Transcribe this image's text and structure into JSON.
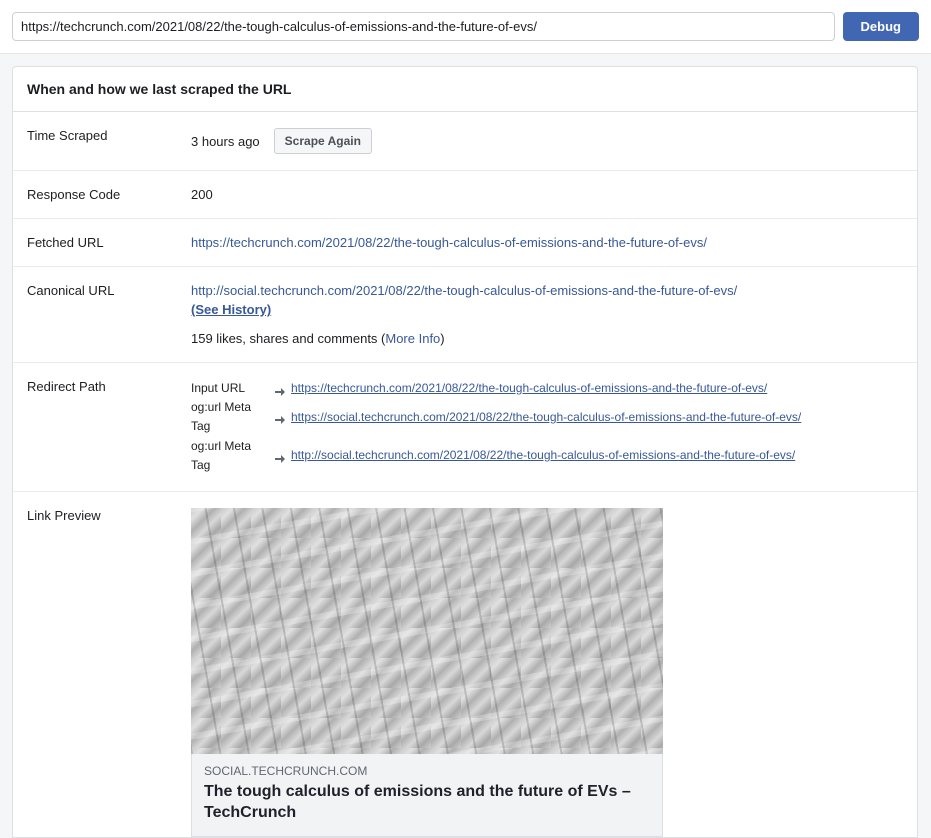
{
  "topbar": {
    "url_value": "https://techcrunch.com/2021/08/22/the-tough-calculus-of-emissions-and-the-future-of-evs/",
    "debug_label": "Debug"
  },
  "panel": {
    "heading": "When and how we last scraped the URL"
  },
  "rows": {
    "time_scraped": {
      "label": "Time Scraped",
      "value": "3 hours ago",
      "scrape_button": "Scrape Again"
    },
    "response_code": {
      "label": "Response Code",
      "value": "200"
    },
    "fetched_url": {
      "label": "Fetched URL",
      "url": "https://techcrunch.com/2021/08/22/the-tough-calculus-of-emissions-and-the-future-of-evs/"
    },
    "canonical_url": {
      "label": "Canonical URL",
      "url": "http://social.techcrunch.com/2021/08/22/the-tough-calculus-of-emissions-and-the-future-of-evs/",
      "see_history": "(See History)",
      "stats_prefix": "159 likes, shares and comments (",
      "more_info": "More Info",
      "stats_suffix": ")"
    },
    "redirect_path": {
      "label": "Redirect Path",
      "items": [
        {
          "type": "Input URL",
          "url": "https://techcrunch.com/2021/08/22/the-tough-calculus-of-emissions-and-the-future-of-evs/"
        },
        {
          "type": "og:url Meta Tag",
          "url": "https://social.techcrunch.com/2021/08/22/the-tough-calculus-of-emissions-and-the-future-of-evs/"
        },
        {
          "type": "og:url Meta Tag",
          "url": "http://social.techcrunch.com/2021/08/22/the-tough-calculus-of-emissions-and-the-future-of-evs/"
        }
      ]
    },
    "link_preview": {
      "label": "Link Preview",
      "domain": "SOCIAL.TECHCRUNCH.COM",
      "title": "The tough calculus of emissions and the future of EVs – TechCrunch"
    }
  }
}
